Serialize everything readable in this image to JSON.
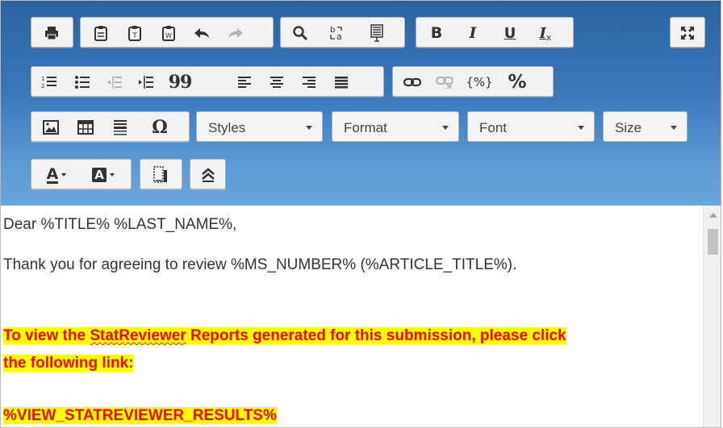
{
  "toolbar": {
    "row1": {
      "print": "print",
      "paste": "paste",
      "paste_text": "paste-as-text",
      "paste_word": "paste-from-word",
      "undo": "undo",
      "redo": "redo",
      "find": "find",
      "replace": "replace",
      "select_all": "select-all",
      "bold_label": "B",
      "italic_label": "I",
      "underline_label": "U",
      "remove_format_label": "I",
      "remove_format_sub": "x",
      "maximize": "maximize"
    },
    "row2": {
      "numbered_list": "numbered-list",
      "bulleted_list": "bulleted-list",
      "outdent": "decrease-indent",
      "indent": "increase-indent",
      "blockquote_label": "99",
      "align_left": "align-left",
      "align_center": "align-center",
      "align_right": "align-right",
      "justify": "justify",
      "link": "link",
      "unlink": "unlink",
      "placeholder_label": "{%}",
      "percent_label": "%"
    },
    "row3": {
      "image": "image",
      "table": "table",
      "horizontal_line": "horizontal-line",
      "special_char_label": "Ω",
      "styles_label": "Styles",
      "format_label": "Format",
      "font_label": "Font",
      "size_label": "Size"
    },
    "row4": {
      "text_color_label": "A",
      "bg_color_label": "A",
      "show_blocks": "show-blocks",
      "collapse_toolbar": "collapse-toolbar"
    }
  },
  "body": {
    "line1": "Dear %TITLE% %LAST_NAME%,",
    "line2": "Thank you for agreeing to review %MS_NUMBER% (%ARTICLE_TITLE%).",
    "line3_pre": "To view the ",
    "line3_word": "StatReviewer",
    "line3_post": " Reports generated for this submission, please click",
    "line4": "the following link:",
    "line5": "%VIEW_STATREVIEWER_RESULTS%"
  },
  "colors": {
    "toolbar_top": "#2a63a0",
    "toolbar_bottom": "#6aa6de",
    "highlight": "#ffff00",
    "highlight_text": "#ff0000"
  }
}
